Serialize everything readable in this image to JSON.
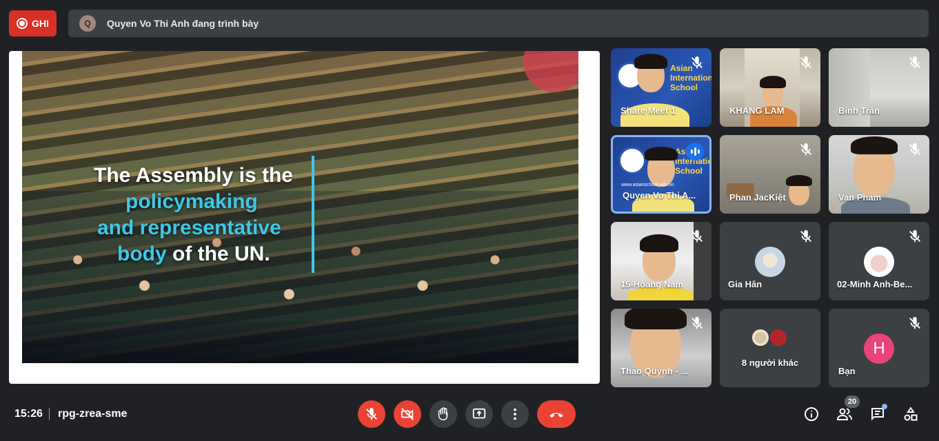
{
  "top": {
    "record_label": "GHI",
    "presenter_initial": "Q",
    "presenter_text": "Quyen Vo Thi Anh đang trình bày"
  },
  "slide": {
    "line1": "The Assembly is the",
    "line2": "policymaking",
    "line3": "and representative",
    "line4_a": "body",
    "line4_b": " of the UN."
  },
  "school": {
    "name_line1": "Asian",
    "name_line2": "International",
    "name_line3": "School",
    "url": "www.asianschool.edu.vn"
  },
  "tiles": [
    {
      "name": "Share Meet 1",
      "mic": "off"
    },
    {
      "name": "KHANG LAM",
      "mic": "off"
    },
    {
      "name": "Bình Trần",
      "mic": "off"
    },
    {
      "name": "Quyen Vo Thi A...",
      "mic": "speaking"
    },
    {
      "name": "Phan JacKiệt",
      "mic": "off"
    },
    {
      "name": "Van Pham",
      "mic": "off"
    },
    {
      "name": "15-Hoàng Nam",
      "mic": "off"
    },
    {
      "name": "Gia Hân",
      "mic": "off"
    },
    {
      "name": "02-Minh Anh-Be...",
      "mic": "off"
    },
    {
      "name": "Thảo Quỳnh - ...",
      "mic": "off"
    },
    {
      "name": "8 người khác",
      "mic": "none"
    },
    {
      "name": "Bạn",
      "mic": "off",
      "avatar_initial": "H"
    }
  ],
  "bottom": {
    "time": "15:26",
    "meeting_code": "rpg-zrea-sme",
    "people_count": "20"
  },
  "colors": {
    "background": "#202124",
    "tile": "#3c4043",
    "danger": "#ea4335",
    "accent": "#8ab4f8",
    "slide_cyan": "#3ec7e8"
  },
  "icons": [
    "mic-off-icon",
    "camera-off-icon",
    "raise-hand-icon",
    "present-icon",
    "more-icon",
    "end-call-icon",
    "info-icon",
    "people-icon",
    "chat-icon",
    "activities-icon"
  ]
}
